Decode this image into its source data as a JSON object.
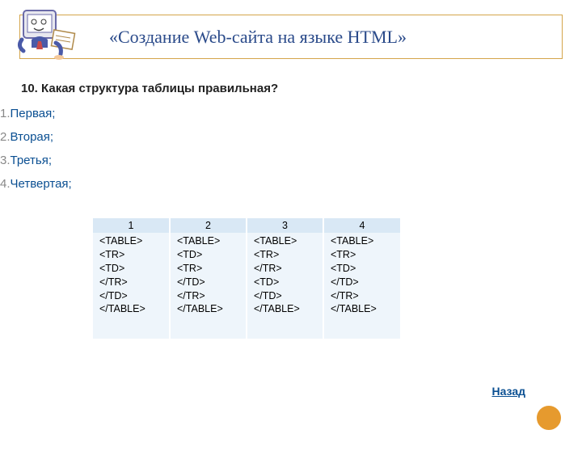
{
  "header": {
    "title_parts": {
      "open": "«",
      "a": "Создание ",
      "b": "Web",
      "c": "-сайта на языке ",
      "d": "HTML",
      "close": "»"
    }
  },
  "question": "10. Какая структура таблицы правильная?",
  "answers": [
    {
      "num": "1.",
      "text": "Первая;"
    },
    {
      "num": "2.",
      "text": "Вторая;"
    },
    {
      "num": "3.",
      "text": "Третья;"
    },
    {
      "num": "4.",
      "text": "Четвертая;"
    }
  ],
  "table": {
    "headers": [
      "1",
      "2",
      "3",
      "4"
    ],
    "cells": [
      "<TABLE>\n<TR>\n<TD>\n</TR>\n</TD>\n</TABLE>",
      "<TABLE>\n<TD>\n<TR>\n</TD>\n</TR>\n</TABLE>",
      "<TABLE>\n<TR>\n</TR>\n<TD>\n</TD>\n</TABLE>",
      "<TABLE>\n<TR>\n<TD>\n</TD>\n</TR>\n</TABLE>"
    ]
  },
  "back_link": "Назад"
}
